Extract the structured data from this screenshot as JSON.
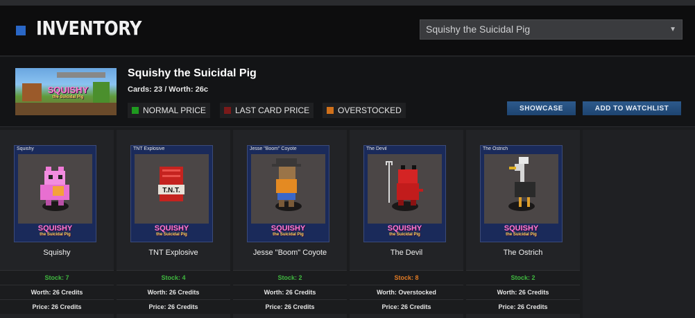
{
  "header": {
    "title": "INVENTORY",
    "selected_game": "Squishy the Suicidal Pig",
    "accent_color": "#2a67c6"
  },
  "game": {
    "name": "Squishy the Suicidal Pig",
    "cards_worth": "Cards: 23 / Worth: 26c",
    "banner_logo": "SQUISHY",
    "banner_tagline": "the Suicidal Pig"
  },
  "legend": [
    {
      "label": "NORMAL PRICE",
      "color": "#1f9a1f"
    },
    {
      "label": "LAST CARD PRICE",
      "color": "#7a1a1a"
    },
    {
      "label": "OVERSTOCKED",
      "color": "#d0701a"
    }
  ],
  "buttons": {
    "showcase": "SHOWCASE",
    "watchlist": "ADD TO WATCHLIST"
  },
  "cards": [
    {
      "art_label": "Squishy",
      "logo": "SQUISHY",
      "tagline": "the Suicidal Pig",
      "name": "Squishy",
      "stock": "Stock: 7",
      "stock_color": "#3fb83f",
      "worth": "Worth: 26 Credits",
      "price": "Price: 26 Credits",
      "icon": "pig-icon"
    },
    {
      "art_label": "TNT Explosive",
      "logo": "SQUISHY",
      "tagline": "the Suicidal Pig",
      "name": "TNT Explosive",
      "stock": "Stock: 4",
      "stock_color": "#3fb83f",
      "worth": "Worth: 26 Credits",
      "price": "Price: 26 Credits",
      "icon": "tnt-icon",
      "tnt_text": "T.N.T."
    },
    {
      "art_label": "Jesse \"Boom\" Coyote",
      "logo": "SQUISHY",
      "tagline": "the Suicidal Pig",
      "name": "Jesse \"Boom\" Coyote",
      "stock": "Stock: 2",
      "stock_color": "#3fb83f",
      "worth": "Worth: 26 Credits",
      "price": "Price: 26 Credits",
      "icon": "coyote-icon"
    },
    {
      "art_label": "The Devil",
      "logo": "SQUISHY",
      "tagline": "the Suicidal Pig",
      "name": "The Devil",
      "stock": "Stock: 8",
      "stock_color": "#e07a24",
      "worth": "Worth: Overstocked",
      "price": "Price: 26 Credits",
      "icon": "devil-icon"
    },
    {
      "art_label": "The Ostrich",
      "logo": "SQUISHY",
      "tagline": "the Suicidal Pig",
      "name": "The Ostrich",
      "stock": "Stock: 2",
      "stock_color": "#3fb83f",
      "worth": "Worth: 26 Credits",
      "price": "Price: 26 Credits",
      "icon": "ostrich-icon"
    }
  ]
}
